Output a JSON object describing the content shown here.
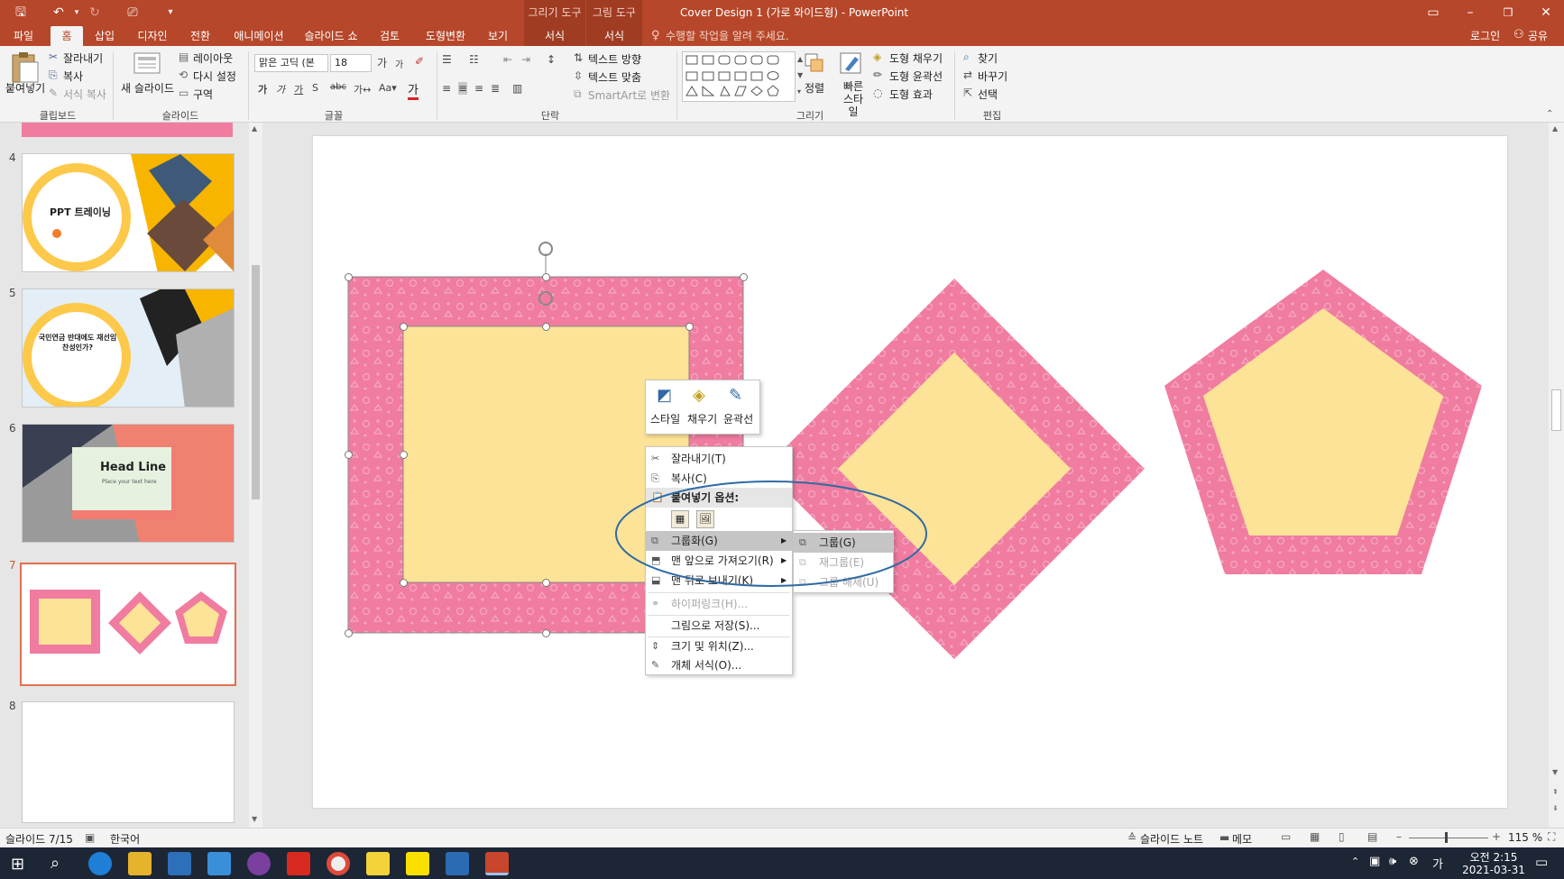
{
  "app": {
    "title": "Cover Design 1 (가로 와이드형) - PowerPoint",
    "accent": "#b7472a"
  },
  "context_groups": {
    "drawing_tools": "그리기 도구",
    "picture_tools": "그림 도구"
  },
  "tabs": [
    "파일",
    "홈",
    "삽입",
    "디자인",
    "전환",
    "애니메이션",
    "슬라이드 쇼",
    "검토",
    "도형변환",
    "보기",
    "서식",
    "서식"
  ],
  "tell_me": "수행할 작업을 알려 주세요.",
  "account": {
    "login": "로그인",
    "share": "공유"
  },
  "ribbon": {
    "clipboard": {
      "paste": "붙여넣기",
      "cut": "잘라내기",
      "copy": "복사",
      "format_painter": "서식 복사",
      "group": "클립보드"
    },
    "slides": {
      "new_slide": "새 슬라이드",
      "layout": "레이아웃",
      "reset": "다시 설정",
      "section": "구역",
      "group": "슬라이드"
    },
    "font": {
      "name": "맑은 고딕 (본",
      "size": "18",
      "group": "글꼴"
    },
    "paragraph": {
      "text_direction": "텍스트 방향",
      "align_text": "텍스트 맞춤",
      "smartart": "SmartArt로 변환",
      "group": "단락"
    },
    "drawing": {
      "arrange": "정렬",
      "quick_styles": "빠른 스타일",
      "fill": "도형 채우기",
      "outline": "도형 윤곽선",
      "effects": "도형 효과",
      "group": "그리기"
    },
    "editing": {
      "find": "찾기",
      "replace": "바꾸기",
      "select": "선택",
      "group": "편집"
    }
  },
  "slides_panel": [
    {
      "num": "4",
      "title": "PPT 트레이닝"
    },
    {
      "num": "5",
      "title": "국민연금 반대에도 재선임 찬성인가?"
    },
    {
      "num": "6",
      "title": "Head Line",
      "subtitle": "Place your text here"
    },
    {
      "num": "7"
    },
    {
      "num": "8"
    }
  ],
  "mini_toolbar": {
    "style": "스타일",
    "fill": "채우기",
    "outline": "윤곽선"
  },
  "context_menu": [
    {
      "label": "잘라내기(T)",
      "icon": "scissors-icon",
      "disabled": false
    },
    {
      "label": "복사(C)",
      "icon": "copy-icon",
      "disabled": false
    },
    {
      "label": "붙여넣기 옵션:",
      "icon": "paste-icon",
      "disabled": false
    },
    {
      "label": "그룹화(G)",
      "icon": "group-icon",
      "disabled": false,
      "submenu": true
    },
    {
      "label": "맨 앞으로 가져오기(R)",
      "icon": "bring-front-icon",
      "disabled": false,
      "submenu": true
    },
    {
      "label": "맨 뒤로 보내기(K)",
      "icon": "send-back-icon",
      "disabled": false,
      "submenu": true
    },
    {
      "label": "하이퍼링크(H)...",
      "icon": "link-icon",
      "disabled": true
    },
    {
      "label": "그림으로 저장(S)...",
      "icon": "",
      "disabled": false
    },
    {
      "label": "크기 및 위치(Z)...",
      "icon": "size-icon",
      "disabled": false
    },
    {
      "label": "개체 서식(O)...",
      "icon": "format-icon",
      "disabled": false
    }
  ],
  "submenu": [
    {
      "label": "그룹(G)",
      "disabled": false
    },
    {
      "label": "재그룹(E)",
      "disabled": true
    },
    {
      "label": "그룹 해제(U)",
      "disabled": true
    }
  ],
  "status": {
    "slide": "슬라이드 7/15",
    "language": "한국어",
    "notes": "슬라이드 노트",
    "comments": "메모",
    "zoom": "115 %"
  },
  "clock": {
    "time": "오전 2:15",
    "date": "2021-03-31"
  },
  "colors": {
    "pink": "#f07ca0",
    "yellow": "#fde397",
    "circle": "#2f6aa3"
  }
}
